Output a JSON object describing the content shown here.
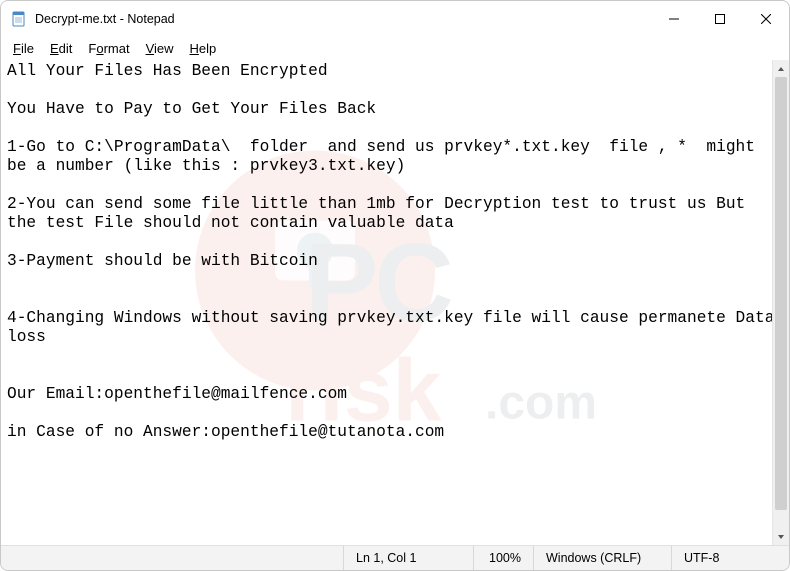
{
  "window": {
    "title": "Decrypt-me.txt - Notepad"
  },
  "menu": {
    "file": "File",
    "edit": "Edit",
    "format": "Format",
    "view": "View",
    "help": "Help"
  },
  "content": "All Your Files Has Been Encrypted\n\nYou Have to Pay to Get Your Files Back\n\n1-Go to C:\\ProgramData\\  folder  and send us prvkey*.txt.key  file , *  might be a number (like this : prvkey3.txt.key)\n\n2-You can send some file little than 1mb for Decryption test to trust us But the test File should not contain valuable data\n\n3-Payment should be with Bitcoin\n\n\n4-Changing Windows without saving prvkey.txt.key file will cause permanete Data loss\n\n\nOur Email:openthefile@mailfence.com\n\nin Case of no Answer:openthefile@tutanota.com",
  "status": {
    "cursor": "Ln 1, Col 1",
    "zoom": "100%",
    "eol": "Windows (CRLF)",
    "encoding": "UTF-8"
  }
}
